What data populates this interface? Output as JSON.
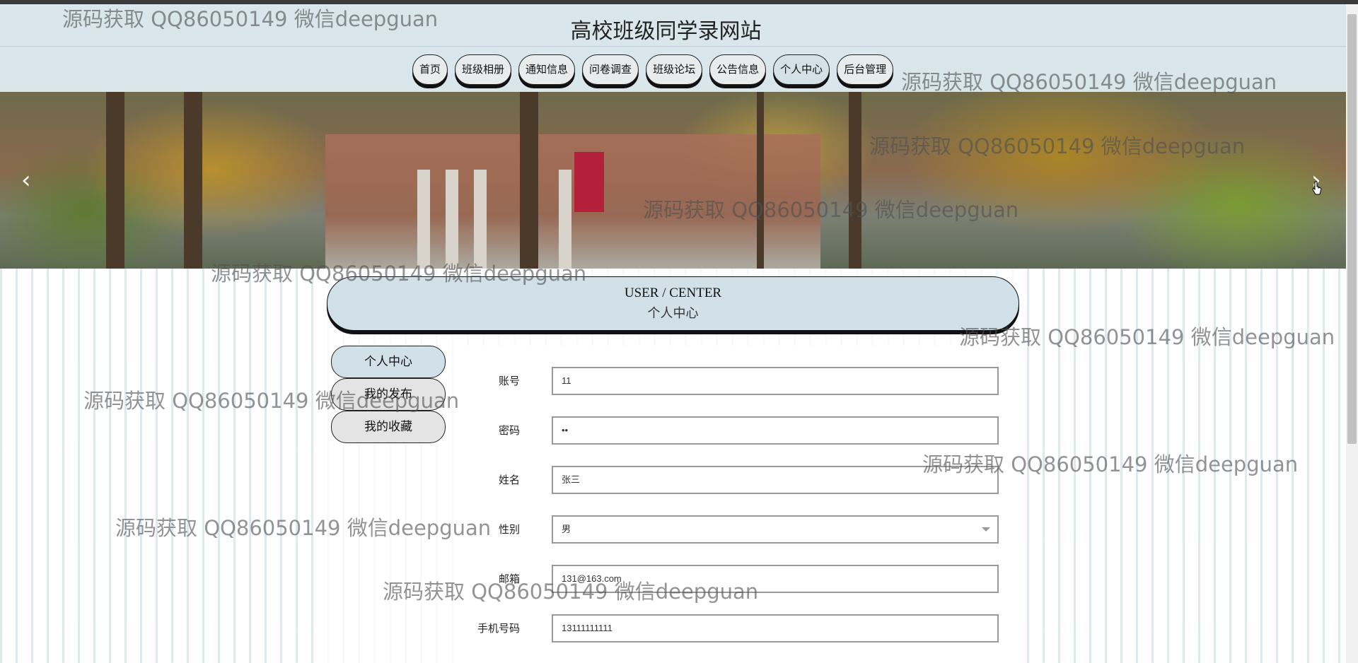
{
  "site": {
    "title": "高校班级同学录网站"
  },
  "nav": {
    "items": [
      "首页",
      "班级相册",
      "通知信息",
      "问卷调查",
      "班级论坛",
      "公告信息",
      "个人中心",
      "后台管理"
    ],
    "active": "个人中心"
  },
  "banner": {
    "prev_icon": "chevron-left-icon",
    "next_icon": "chevron-right-icon",
    "prev": "‹",
    "next": "›"
  },
  "section": {
    "title_en": "USER / CENTER",
    "title_cn": "个人中心"
  },
  "side_menu": {
    "items": [
      "个人中心",
      "我的发布",
      "我的收藏"
    ],
    "active": "个人中心"
  },
  "form": {
    "account_label": "账号",
    "account_value": "11",
    "password_label": "密码",
    "password_value": "••",
    "name_label": "姓名",
    "name_value": "张三",
    "gender_label": "性别",
    "gender_value": "男",
    "email_label": "邮箱",
    "email_value": "131@163.com",
    "phone_label": "手机号码",
    "phone_value": "13111111111"
  },
  "watermark": {
    "text": "源码获取 QQ86050149 微信deepguan"
  },
  "colors": {
    "header_bg": "#d9e6ec",
    "accent": "#d2e1e7",
    "button_bg": "#e9ecec"
  }
}
